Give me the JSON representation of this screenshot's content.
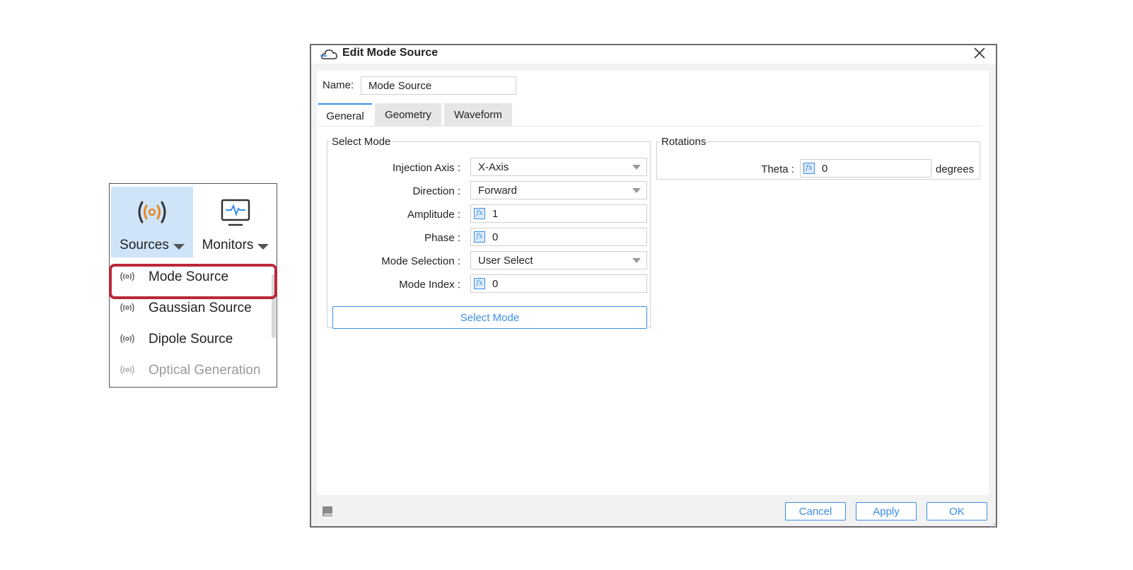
{
  "toolbar": {
    "sources_label": "Sources",
    "monitors_label": "Monitors",
    "accent_color": "#e58a1f",
    "highlight_color": "#b8283a",
    "menu_items": [
      {
        "label": "Mode Source",
        "icon": "source-icon",
        "enabled": true,
        "highlighted": true
      },
      {
        "label": "Gaussian Source",
        "icon": "source-icon",
        "enabled": true
      },
      {
        "label": "Dipole Source",
        "icon": "source-icon",
        "enabled": true
      },
      {
        "label": "Optical Generation",
        "icon": "source-icon",
        "enabled": false
      }
    ]
  },
  "dialog": {
    "title": "Edit Mode Source",
    "title_icon": "cloud-edit-icon",
    "name_label": "Name:",
    "name_value": "Mode Source",
    "tabs": [
      {
        "label": "General",
        "active": true
      },
      {
        "label": "Geometry",
        "active": false
      },
      {
        "label": "Waveform",
        "active": false
      }
    ],
    "select_mode": {
      "legend": "Select Mode",
      "fields": [
        {
          "label": "Injection Axis :",
          "value": "X-Axis",
          "kind": "dropdown"
        },
        {
          "label": "Direction :",
          "value": "Forward",
          "kind": "dropdown"
        },
        {
          "label": "Amplitude :",
          "value": "1",
          "kind": "fx"
        },
        {
          "label": "Phase :",
          "value": "0",
          "kind": "fx"
        },
        {
          "label": "Mode Selection :",
          "value": "User Select",
          "kind": "dropdown"
        },
        {
          "label": "Mode Index :",
          "value": "0",
          "kind": "fx"
        }
      ],
      "button_label": "Select Mode"
    },
    "rotations": {
      "legend": "Rotations",
      "theta_label": "Theta :",
      "theta_value": "0",
      "theta_unit": "degrees"
    },
    "footer": {
      "cancel_label": "Cancel",
      "apply_label": "Apply",
      "ok_label": "OK"
    },
    "accent_color": "#3a8ee6"
  }
}
